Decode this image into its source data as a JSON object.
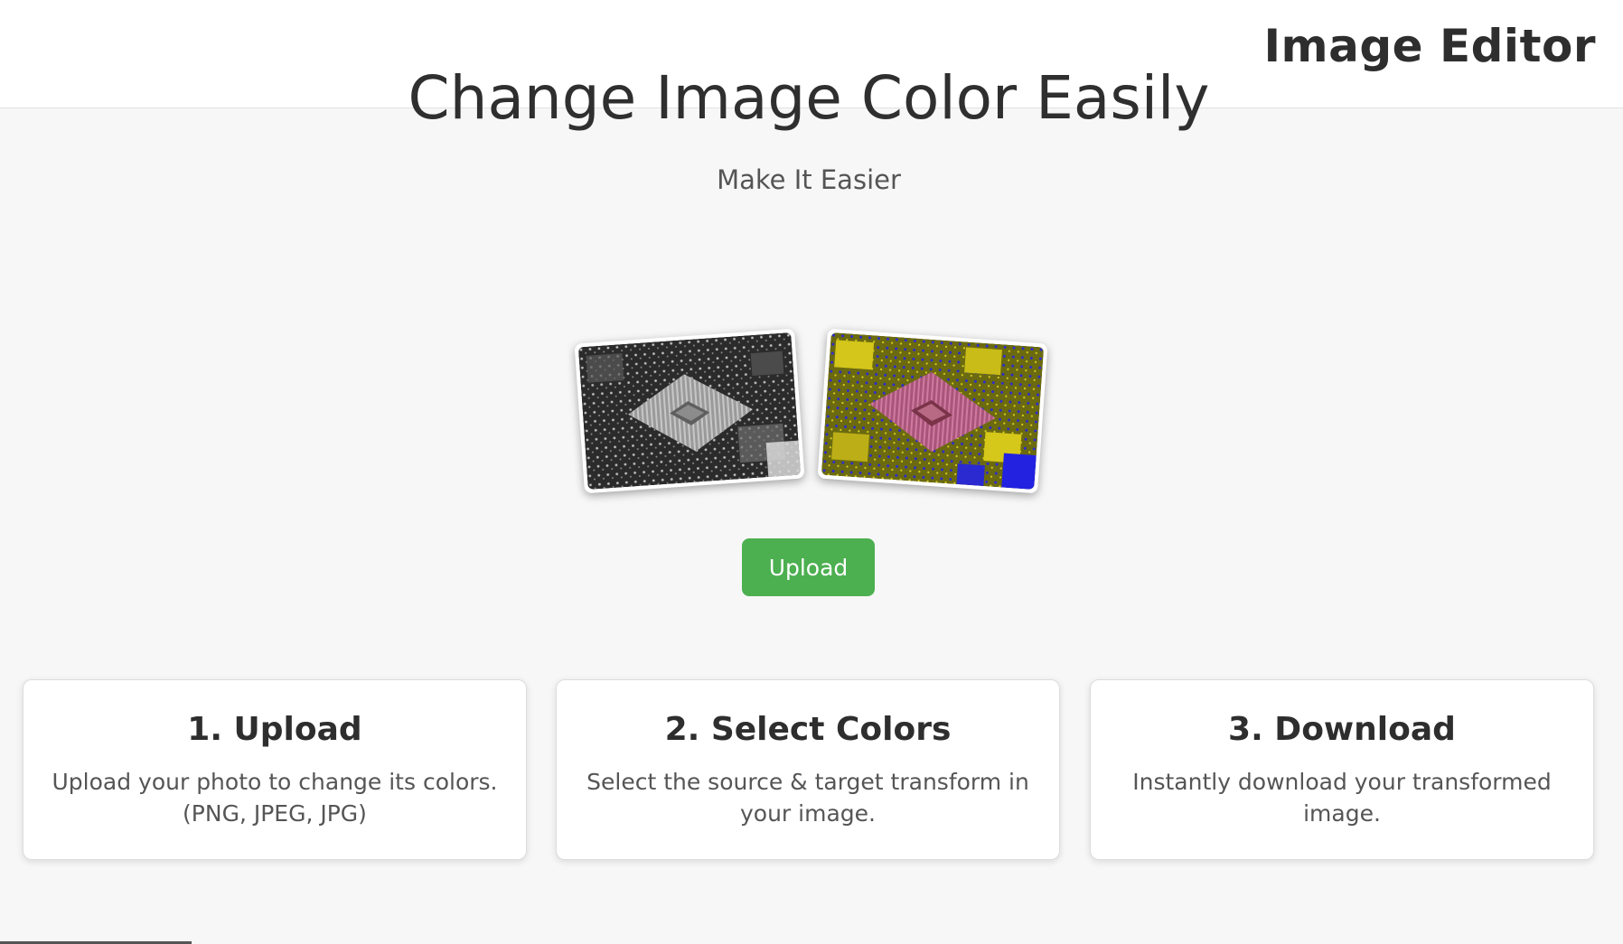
{
  "header": {
    "brand": "Image Editor"
  },
  "hero": {
    "title": "Change Image Color Easily",
    "subtitle": "Make It Easier",
    "upload_label": "Upload"
  },
  "previews": [
    {
      "name": "original grayscale CPU chip"
    },
    {
      "name": "recolored CPU chip"
    }
  ],
  "steps": [
    {
      "title": "1. Upload",
      "description": "Upload your photo to change its colors. (PNG, JPEG, JPG)"
    },
    {
      "title": "2. Select Colors",
      "description": "Select the source & target transform in your image."
    },
    {
      "title": "3. Download",
      "description": "Instantly download your transformed image."
    }
  ],
  "colors": {
    "accent": "#4caf50",
    "text": "#2f2f2f",
    "muted": "#555555",
    "background": "#f7f7f7"
  }
}
